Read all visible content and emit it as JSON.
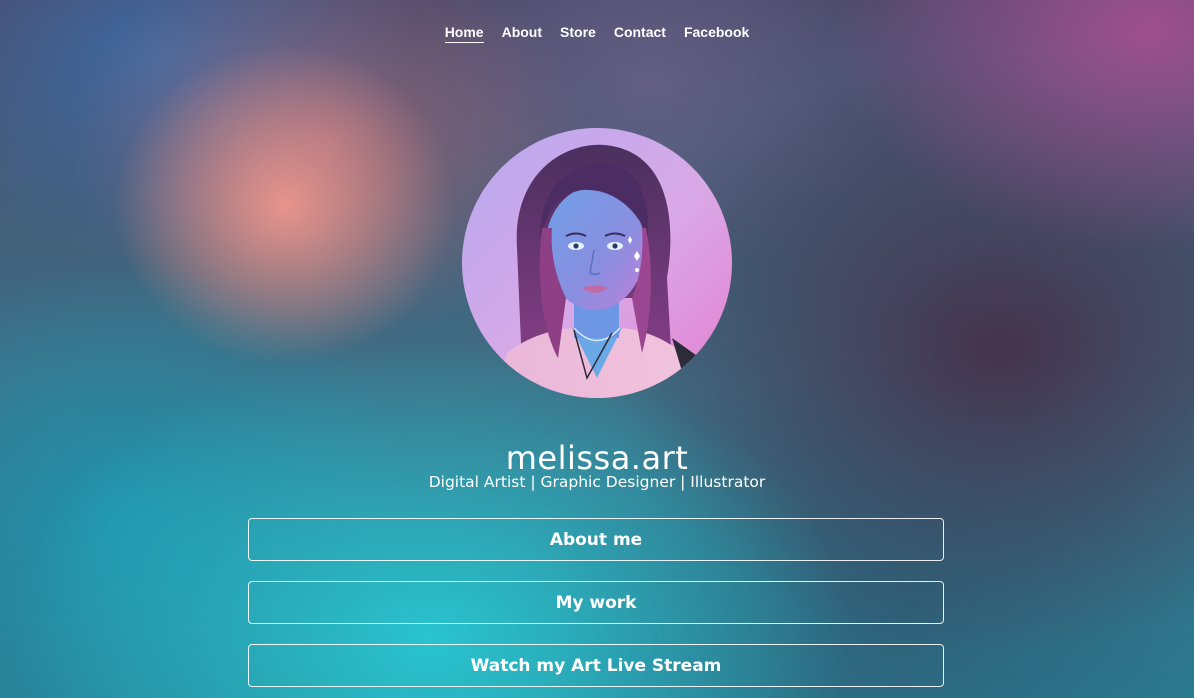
{
  "nav": {
    "items": [
      {
        "label": "Home",
        "active": true
      },
      {
        "label": "About",
        "active": false
      },
      {
        "label": "Store",
        "active": false
      },
      {
        "label": "Contact",
        "active": false
      },
      {
        "label": "Facebook",
        "active": false
      }
    ]
  },
  "profile": {
    "name": "melissa.art",
    "tagline": "Digital Artist | Graphic Designer | Illustrator",
    "avatar_icon": "profile-photo"
  },
  "links": [
    {
      "label": "About me"
    },
    {
      "label": "My work"
    },
    {
      "label": "Watch my Art Live Stream"
    }
  ],
  "colors": {
    "text": "#ffffff",
    "button_border": "#ffffff",
    "accent_teal": "#28c8d2",
    "accent_pink": "#ee968c"
  }
}
